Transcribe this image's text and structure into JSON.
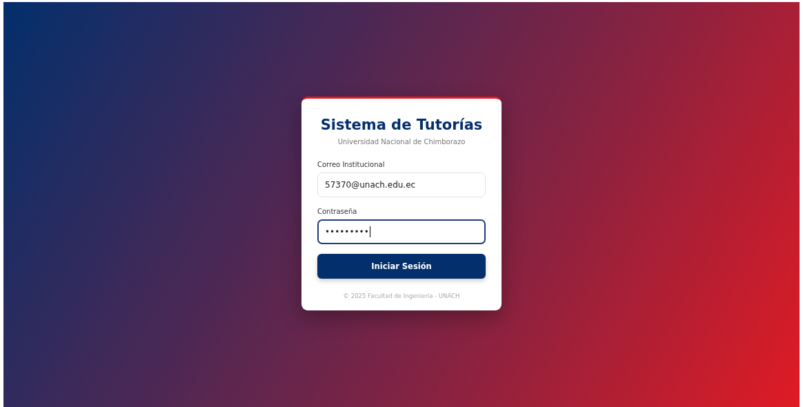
{
  "title": "Sistema de Tutorías",
  "subtitle": "Universidad Nacional de Chimborazo",
  "fields": [
    {
      "label": "Correo Institucional",
      "value": "57370@unach.edu.ec",
      "focused": false
    },
    {
      "label": "Contraseña",
      "value": "•••••••••",
      "focused": true
    }
  ],
  "button": "Iniciar Sesión",
  "footer": "© 2025 Facultad de Ingeniería - UNACH"
}
